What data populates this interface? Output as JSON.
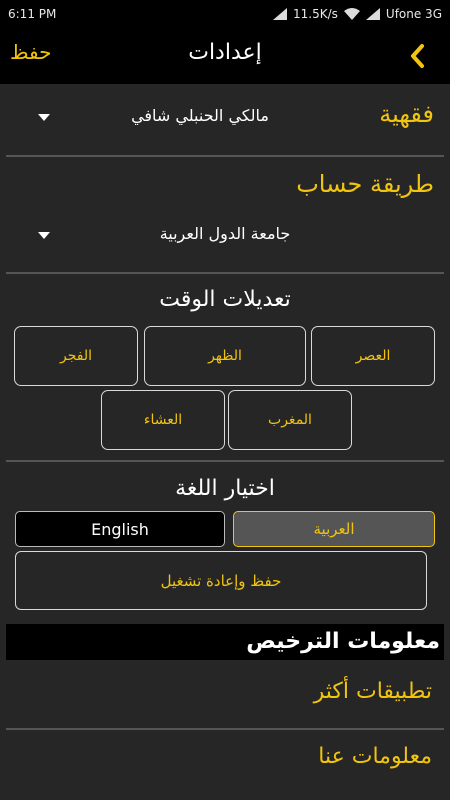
{
  "status_bar": {
    "time": "6:11 PM",
    "speed": "11.5K/s",
    "carrier": "Ufone 3G"
  },
  "app_bar": {
    "save_label": "حفظ",
    "title": "إعدادات",
    "back_icon": "chevron-left-icon"
  },
  "fiqh": {
    "label": "فقهية",
    "value": "مالكي الحنبلي شافي"
  },
  "calc_method": {
    "label": "طريقة حساب",
    "value": "جامعة الدول العربية"
  },
  "time_adjust": {
    "title": "تعديلات الوقت",
    "fajr": "الفجر",
    "dhuhr": "الظهر",
    "asr": "العصر",
    "maghrib": "المغرب",
    "isha": "العشاء"
  },
  "language": {
    "title": "اختيار اللغة",
    "english": "English",
    "arabic": "العربية",
    "selected": "العربية",
    "save_restart": "حفظ وإعادة تشغيل"
  },
  "license": {
    "title": "معلومات الترخيص"
  },
  "links": {
    "more_apps": "تطبيقات أكثر",
    "about": "معلومات عنا"
  },
  "colors": {
    "accent": "#f1c40f",
    "background": "#262626",
    "bar": "#000000"
  }
}
